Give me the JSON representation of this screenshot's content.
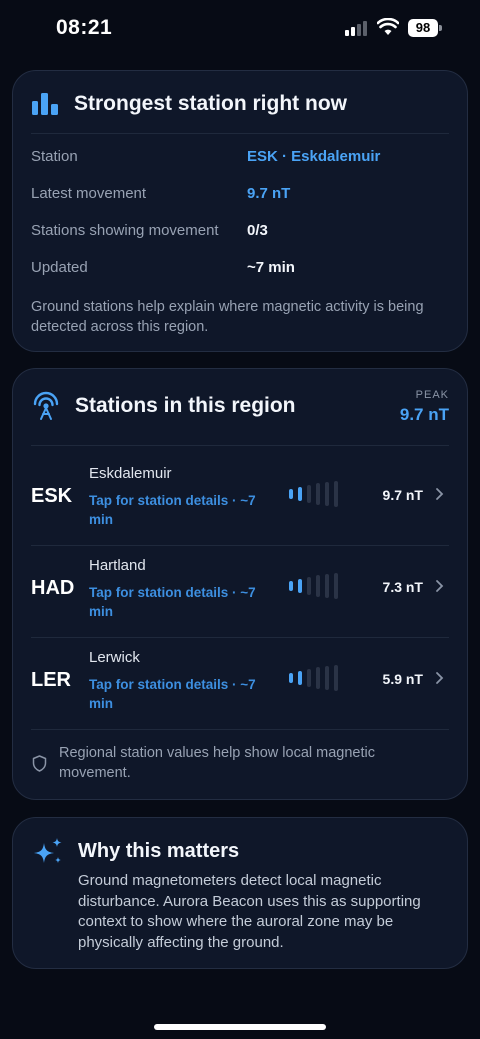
{
  "status_bar": {
    "time": "08:21",
    "battery": "98"
  },
  "strongest": {
    "title": "Strongest station right now",
    "icon": "bar-chart-icon",
    "rows": [
      {
        "label": "Station",
        "value": "ESK · Eskdalemuir",
        "accent": true
      },
      {
        "label": "Latest movement",
        "value": "9.7 nT",
        "accent": true
      },
      {
        "label": "Stations showing movement",
        "value": "0/3",
        "accent": false
      },
      {
        "label": "Updated",
        "value": "~7 min",
        "accent": false
      }
    ],
    "note": "Ground stations help explain where magnetic activity is being detected across this region."
  },
  "region": {
    "title": "Stations in this region",
    "icon": "antenna-icon",
    "peak_label": "PEAK",
    "peak_value": "9.7 nT",
    "stations": [
      {
        "code": "ESK",
        "name": "Eskdalemuir",
        "sub": "Tap for station details · ~7 min",
        "value": "9.7 nT",
        "level": 2
      },
      {
        "code": "HAD",
        "name": "Hartland",
        "sub": "Tap for station details · ~7 min",
        "value": "7.3 nT",
        "level": 2
      },
      {
        "code": "LER",
        "name": "Lerwick",
        "sub": "Tap for station details · ~7 min",
        "value": "5.9 nT",
        "level": 2
      }
    ],
    "footnote": "Regional station values help show local magnetic movement."
  },
  "why": {
    "title": "Why this matters",
    "icon": "sparkles-icon",
    "body": "Ground magnetometers detect local magnetic disturbance. Aurora Beacon uses this as supporting context to show where the auroral zone may be physically affecting the ground."
  },
  "colors": {
    "accent": "#4aa3f5",
    "background": "#070b15",
    "card": "#0f1729"
  }
}
